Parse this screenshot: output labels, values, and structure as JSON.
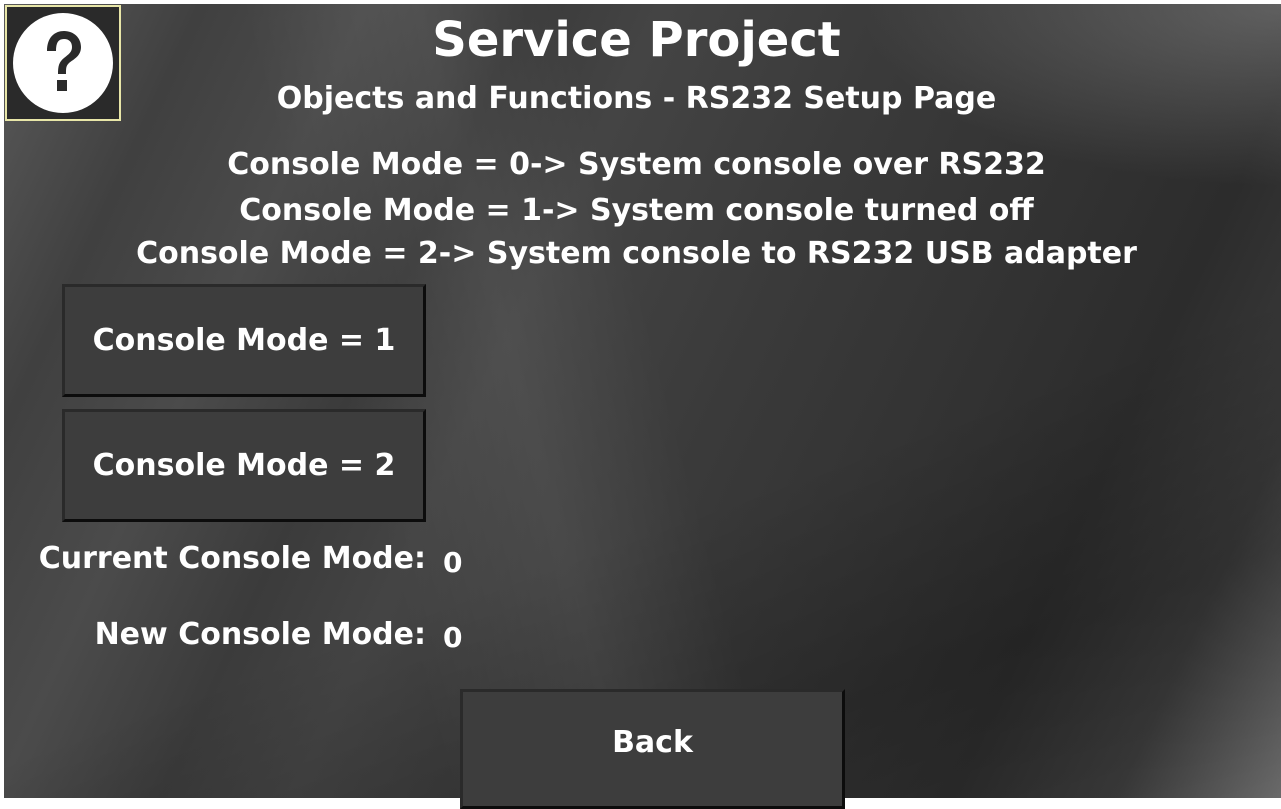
{
  "header": {
    "title": "Service Project",
    "subtitle": "Objects and Functions - RS232 Setup Page",
    "help_icon": "question-mark-icon"
  },
  "mode_descriptions": [
    "Console Mode = 0-> System console over RS232",
    "Console Mode = 1-> System console turned off",
    "Console Mode = 2-> System console to RS232 USB adapter"
  ],
  "buttons": {
    "mode1_label": "Console Mode = 1",
    "mode2_label": "Console Mode = 2",
    "back_label": "Back"
  },
  "status": {
    "current_label": "Current Console Mode:",
    "current_value": "0",
    "new_label": "New Console Mode:",
    "new_value": "0"
  },
  "colors": {
    "text": "#ffffff",
    "help_border": "#e8e6a8",
    "button_face": "#3d3d3d"
  }
}
